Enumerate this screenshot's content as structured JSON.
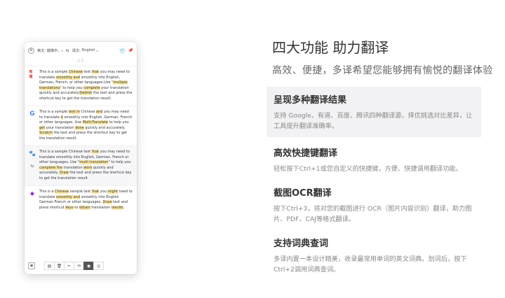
{
  "app": {
    "source_lang": "英文: 摄像中..",
    "target_label": "译文:",
    "target_lang": "English",
    "drag_handle": "⠿⠿",
    "results": [
      {
        "engine": "youdao-icon",
        "logo": "有道",
        "sub_icon": "",
        "segments": [
          {
            "t": "This is a sample ",
            "h": false
          },
          {
            "t": "Chinese",
            "h": true
          },
          {
            "t": " text ",
            "h": false
          },
          {
            "t": "that",
            "h": true
          },
          {
            "t": " you may need to translate ",
            "h": false
          },
          {
            "t": "smoothly and",
            "h": true
          },
          {
            "t": " smoothly into English, German, French, or other languages.Use \"",
            "h": false
          },
          {
            "t": "multiple translations",
            "h": true
          },
          {
            "t": "\" to help you ",
            "h": false
          },
          {
            "t": "complete",
            "h": true
          },
          {
            "t": " your translation quickly and accurately.",
            "h": false
          },
          {
            "t": "Delimit",
            "h": true
          },
          {
            "t": " the text and press the shortcut key to get the translation result.",
            "h": false
          }
        ]
      },
      {
        "engine": "google-icon",
        "logo": "G",
        "sub_icon": "",
        "segments": [
          {
            "t": "This is a sample ",
            "h": false
          },
          {
            "t": "text in",
            "h": true
          },
          {
            "t": " Chinese ",
            "h": false
          },
          {
            "t": "and",
            "h": true
          },
          {
            "t": " you may need to translate ",
            "h": false
          },
          {
            "t": "it",
            "h": true
          },
          {
            "t": " smoothly into English, German, French or other languages. Use ",
            "h": false
          },
          {
            "t": "Multi-Translate",
            "h": true
          },
          {
            "t": " to help you ",
            "h": false
          },
          {
            "t": "get",
            "h": true
          },
          {
            "t": " your translation ",
            "h": false
          },
          {
            "t": "done",
            "h": true
          },
          {
            "t": " quickly and accurately. ",
            "h": false
          },
          {
            "t": "Scratch",
            "h": true
          },
          {
            "t": " the text and press the shortcut key to get the translation result.",
            "h": false
          }
        ]
      },
      {
        "engine": "baidu-icon",
        "logo": "🐾",
        "sub_icon": "⇆",
        "segments": [
          {
            "t": "This is a sample Chinese text ",
            "h": false
          },
          {
            "t": "that",
            "h": true
          },
          {
            "t": " you may need to translate smoothly into English, German, French or other languages. Use \"",
            "h": false
          },
          {
            "t": "multi translation",
            "h": true
          },
          {
            "t": "\" to help you ",
            "h": false
          },
          {
            "t": "complete the",
            "h": true
          },
          {
            "t": " translation ",
            "h": false
          },
          {
            "t": "work",
            "h": true
          },
          {
            "t": " quickly and accurately. ",
            "h": false
          },
          {
            "t": "Draw",
            "h": true
          },
          {
            "t": " the text and press the shortcut key to get the translation result.",
            "h": false
          }
        ]
      },
      {
        "engine": "tencent-icon",
        "logo": "◆",
        "sub_icon": "",
        "segments": [
          {
            "t": "This is a ",
            "h": false
          },
          {
            "t": "Chinese",
            "h": true
          },
          {
            "t": " sample text ",
            "h": false
          },
          {
            "t": "that",
            "h": true
          },
          {
            "t": " you ",
            "h": false
          },
          {
            "t": "might",
            "h": true
          },
          {
            "t": " need to translate ",
            "h": false
          },
          {
            "t": "smoothly and",
            "h": true
          },
          {
            "t": " smoothly into English German French or other languages. ",
            "h": false
          },
          {
            "t": "Draw",
            "h": true
          },
          {
            "t": " text and press shortcut ",
            "h": false
          },
          {
            "t": "keys",
            "h": true
          },
          {
            "t": " to ",
            "h": false
          },
          {
            "t": "obtain",
            "h": true
          },
          {
            "t": " translation ",
            "h": false
          },
          {
            "t": "results",
            "h": true
          },
          {
            "t": ".",
            "h": false
          }
        ]
      }
    ],
    "footer_tools": [
      "▤",
      "🗑",
      "✂",
      "⟲",
      "◉",
      "◎"
    ],
    "footer_active_index": 4
  },
  "heading": {
    "title": "四大功能 助力翻译",
    "subtitle": "高效、便捷，多译希望您能够拥有愉悦的翻译体验"
  },
  "features": [
    {
      "title": "呈现多种翻译结果",
      "desc": "支持 Google、有道、百度、腾讯四种翻译源，择优挑选对比差异，让工具提升翻译准确率。",
      "active": true
    },
    {
      "title": "高效快捷键翻译",
      "desc": "轻松按下Ctrl+1或您自定义的快捷键，方便、快捷调用翻译功能。",
      "active": false
    },
    {
      "title": "截图OCR翻译",
      "desc": "按下Ctrl+3，将对您的截图进行 OCR（图片内容识别）翻译，助力图片、PDF、CAJ等格式翻译。",
      "active": false
    },
    {
      "title": "支持词典查词",
      "desc": "多译内置一本设计精美，收录最常用单词的英文词典。划词后，按下Ctrl+2调用词典查词。",
      "active": false
    }
  ]
}
